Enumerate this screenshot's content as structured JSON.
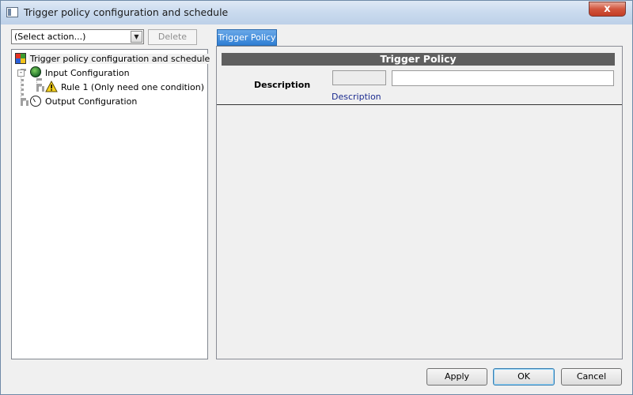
{
  "window": {
    "title": "Trigger policy configuration and schedule",
    "close_label": "x"
  },
  "left": {
    "action_select": {
      "value": "(Select action...)"
    },
    "delete_label": "Delete",
    "tree": {
      "root": {
        "label": "Trigger policy configuration and schedule",
        "icon": "color-grid-icon"
      },
      "input": {
        "label": "Input Configuration",
        "icon": "globe-icon",
        "expander": "-"
      },
      "rule": {
        "label": "Rule 1 (Only need one condition)",
        "icon": "warning-icon"
      },
      "output": {
        "label": "Output Configuration",
        "icon": "clock-icon"
      }
    }
  },
  "right": {
    "tab_label": "Trigger Policy",
    "header": "Trigger Policy",
    "description_label": "Description",
    "description_value": "",
    "description_link": "Description"
  },
  "footer": {
    "apply_label": "Apply",
    "ok_label": "OK",
    "cancel_label": "Cancel"
  },
  "colors": {
    "tab_active": "#2f7fd4",
    "header_bg": "#5f5f5f",
    "close_button": "#c33d25",
    "link": "#1b2b8f"
  }
}
